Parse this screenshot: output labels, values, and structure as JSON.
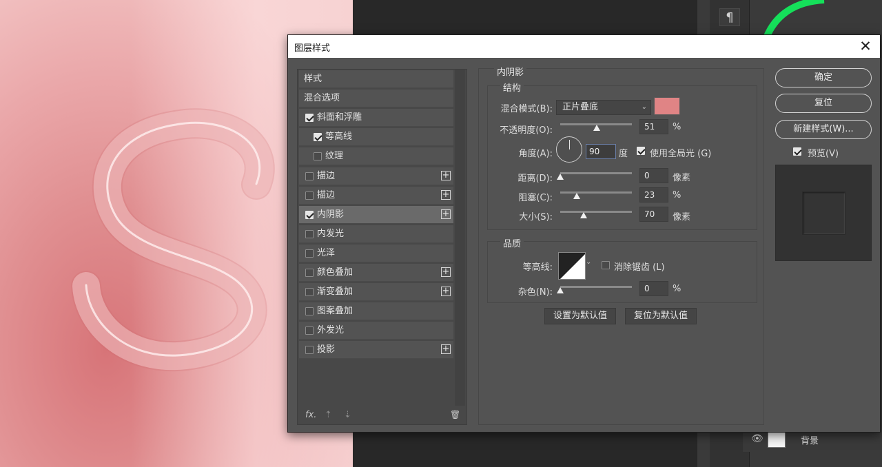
{
  "dialog": {
    "title": "图层样式",
    "close_glyph": "✕"
  },
  "styles_list": {
    "items": [
      {
        "label": "样式",
        "checkbox": false,
        "checked": false,
        "plus": false,
        "selected": false
      },
      {
        "label": "混合选项",
        "checkbox": false,
        "checked": false,
        "plus": false,
        "selected": false
      },
      {
        "label": "斜面和浮雕",
        "checkbox": true,
        "checked": true,
        "plus": false,
        "selected": false
      },
      {
        "label": "等高线",
        "checkbox": true,
        "checked": true,
        "plus": false,
        "selected": false,
        "indent": true
      },
      {
        "label": "纹理",
        "checkbox": true,
        "checked": false,
        "plus": false,
        "selected": false,
        "indent": true
      },
      {
        "label": "描边",
        "checkbox": true,
        "checked": false,
        "plus": true,
        "selected": false
      },
      {
        "label": "描边",
        "checkbox": true,
        "checked": false,
        "plus": true,
        "selected": false
      },
      {
        "label": "内阴影",
        "checkbox": true,
        "checked": true,
        "plus": true,
        "selected": true
      },
      {
        "label": "内发光",
        "checkbox": true,
        "checked": false,
        "plus": false,
        "selected": false
      },
      {
        "label": "光泽",
        "checkbox": true,
        "checked": false,
        "plus": false,
        "selected": false
      },
      {
        "label": "颜色叠加",
        "checkbox": true,
        "checked": false,
        "plus": true,
        "selected": false
      },
      {
        "label": "渐变叠加",
        "checkbox": true,
        "checked": false,
        "plus": true,
        "selected": false
      },
      {
        "label": "图案叠加",
        "checkbox": true,
        "checked": false,
        "plus": false,
        "selected": false
      },
      {
        "label": "外发光",
        "checkbox": true,
        "checked": false,
        "plus": false,
        "selected": false
      },
      {
        "label": "投影",
        "checkbox": true,
        "checked": false,
        "plus": true,
        "selected": false
      }
    ],
    "footer": {
      "fx": "fx.",
      "up": "⇡",
      "down": "⇣",
      "trash": "🗑"
    }
  },
  "inner_shadow": {
    "section_title": "内阴影",
    "structure_title": "结构",
    "blend_mode_label": "混合模式(B):",
    "blend_mode_value": "正片叠底",
    "color": "#e08485",
    "opacity_label": "不透明度(O):",
    "opacity_value": "51",
    "opacity_unit": "%",
    "angle_label": "角度(A):",
    "angle_value": "90",
    "angle_unit": "度",
    "global_light_label": "使用全局光 (G)",
    "global_light_checked": true,
    "distance_label": "距离(D):",
    "distance_value": "0",
    "distance_unit": "像素",
    "choke_label": "阻塞(C):",
    "choke_value": "23",
    "choke_unit": "%",
    "size_label": "大小(S):",
    "size_value": "70",
    "size_unit": "像素",
    "quality_title": "品质",
    "contour_label": "等高线:",
    "antialias_label": "消除锯齿 (L)",
    "antialias_checked": false,
    "noise_label": "杂色(N):",
    "noise_value": "0",
    "noise_unit": "%",
    "set_default_button": "设置为默认值",
    "reset_default_button": "复位为默认值"
  },
  "right_panel": {
    "ok_button": "确定",
    "reset_button": "复位",
    "new_style_button": "新建样式(W)...",
    "preview_label": "预览(V)",
    "preview_checked": true
  },
  "photoshop": {
    "paragraph_icon": "¶",
    "layer_name": "背景",
    "eye_icon": "👁"
  }
}
